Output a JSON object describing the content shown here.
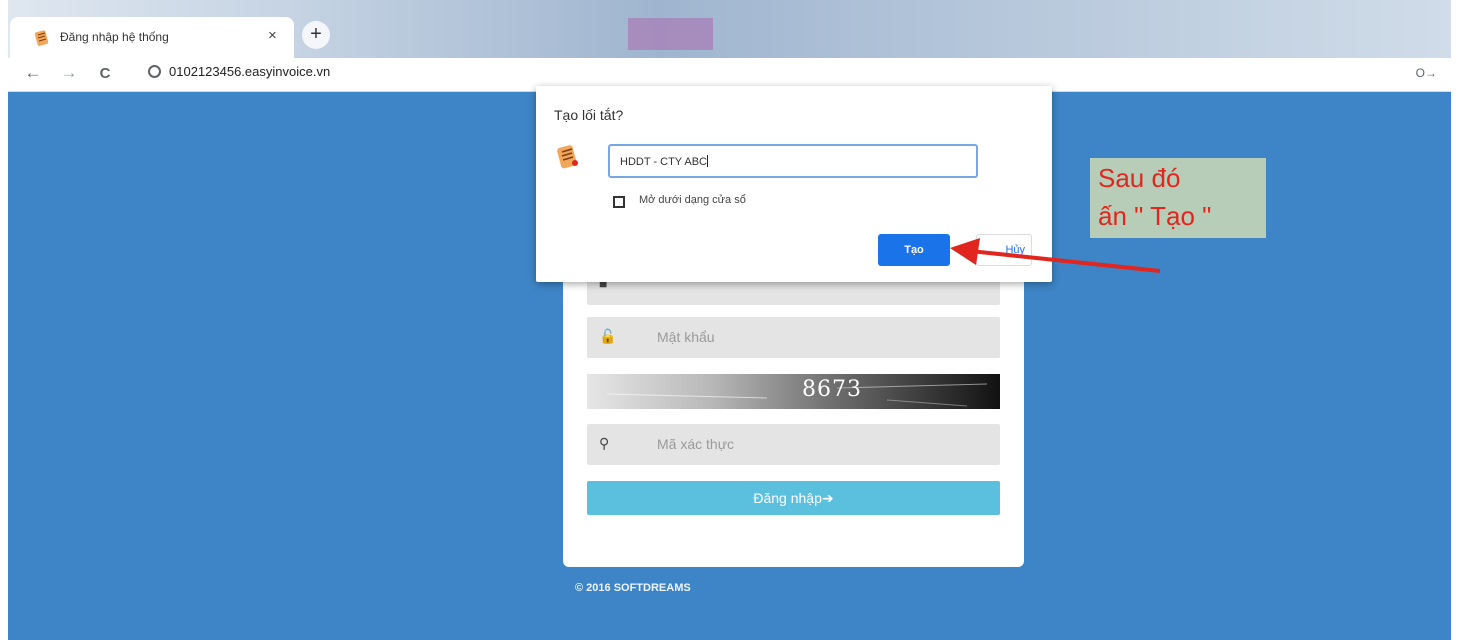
{
  "browser": {
    "tab_title": "Đăng nhập hệ thống",
    "tab_close": "×",
    "new_tab": "+",
    "url": "0102123456.easyinvoice.vn",
    "nav": {
      "back": "←",
      "forward": "→",
      "reload": "C"
    },
    "key_icon": "O→"
  },
  "login": {
    "password_placeholder": "Mật khẩu",
    "captcha_code": "8673",
    "verify_placeholder": "Mã xác thực",
    "login_button": "Đăng nhập",
    "login_icon": "➔",
    "copyright": "© 2016 SOFTDREAMS"
  },
  "dialog": {
    "title": "Tạo lối tắt?",
    "name_value": "HDDT - CTY ABC",
    "checkbox_label": "Mở dưới dạng cửa sổ",
    "checkbox_checked": false,
    "create_button": "Tạo",
    "cancel_button": "Hủy",
    "accent": "#1a73e8"
  },
  "annotation": {
    "line1": "Sau đó",
    "line2": "ấn \" Tạo \"",
    "color": "#e0261f"
  },
  "icons": {
    "favicon": "scroll-icon",
    "user": "user-icon",
    "password": "lock-icon",
    "verify": "key-icon"
  }
}
